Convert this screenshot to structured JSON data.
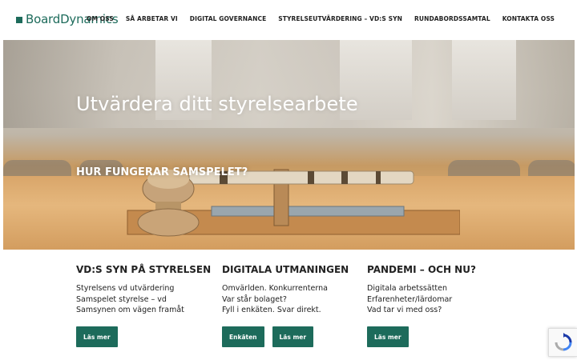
{
  "header": {
    "logo_text": "BoardDynamics",
    "nav": [
      "OM OSS",
      "SÅ ARBETAR VI",
      "DIGITAL GOVERNANCE",
      "STYRELSEUTVÄRDERING – VD:S SYN",
      "RUNDABORDSSAMTAL",
      "KONTAKTA OSS"
    ]
  },
  "hero": {
    "title": "Utvärdera ditt styrelsearbete",
    "subtitle": "HUR FUNGERAR SAMSPELET?"
  },
  "columns": [
    {
      "heading": "VD:S SYN PÅ STYRELSEN",
      "lines": [
        "Styrelsens vd utvärdering",
        "Samspelet styrelse – vd",
        "Samsynen om vägen framåt"
      ],
      "buttons": [
        "Läs mer"
      ]
    },
    {
      "heading": "DIGITALA UTMANINGEN",
      "lines": [
        "Omvärlden. Konkurrenterna",
        "Var står bolaget?",
        "Fyll i enkäten. Svar direkt."
      ],
      "buttons": [
        "Enkäten",
        "Läs mer"
      ]
    },
    {
      "heading": "PANDEMI – OCH NU?",
      "lines": [
        "Digitala arbetssätten",
        "Erfarenheter/lärdomar",
        "Vad tar vi med oss?"
      ],
      "buttons": [
        "Läs mer"
      ]
    }
  ],
  "colors": {
    "brand": "#1d6b5b",
    "text": "#222222",
    "button_text": "#ffffff"
  },
  "icons": {
    "logo": "boarddynamics-logo-mark",
    "recaptcha": "recaptcha-icon"
  }
}
